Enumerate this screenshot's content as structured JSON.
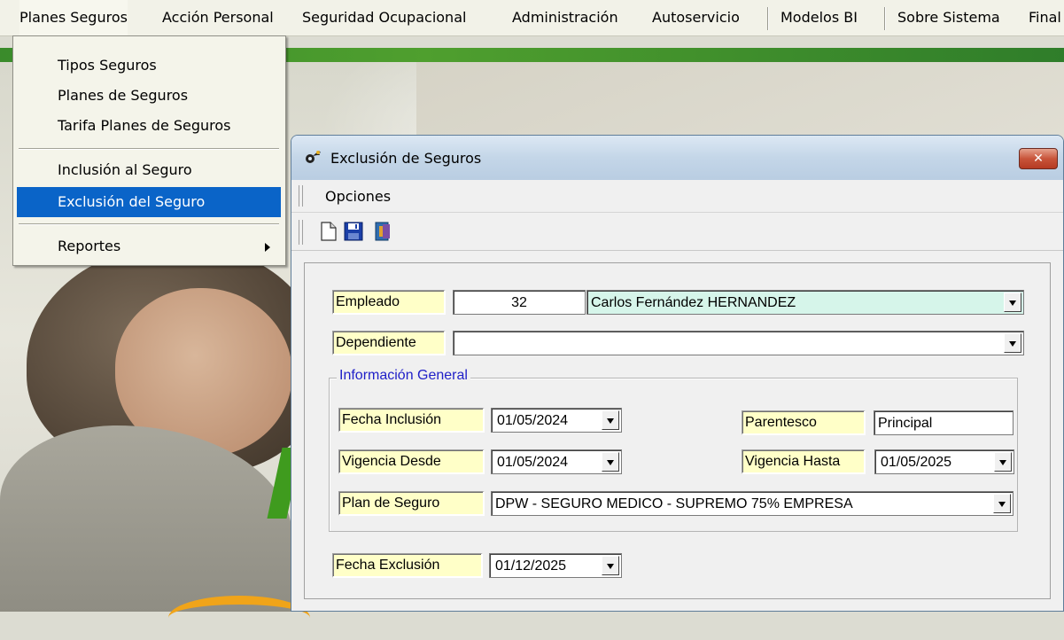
{
  "menubar": {
    "items": [
      {
        "label": "Planes Seguros"
      },
      {
        "label": "Acción Personal"
      },
      {
        "label": "Seguridad Ocupacional"
      },
      {
        "label": "Administración"
      },
      {
        "label": "Autoservicio"
      },
      {
        "label": "Modelos BI"
      },
      {
        "label": "Sobre Sistema"
      },
      {
        "label": "Final"
      }
    ]
  },
  "dropdown": {
    "items": [
      {
        "label": "Tipos Seguros"
      },
      {
        "label": "Planes de Seguros"
      },
      {
        "label": "Tarifa Planes de Seguros"
      },
      {
        "label": "Inclusión al Seguro"
      },
      {
        "label": "Exclusión del Seguro"
      },
      {
        "label": "Reportes"
      }
    ],
    "selected": "Exclusión del Seguro"
  },
  "window": {
    "title": "Exclusión de Seguros",
    "close_label": "✕",
    "menu_opciones": "Opciones",
    "toolbar_icons": [
      "new-document-icon",
      "save-icon",
      "exit-icon"
    ]
  },
  "form": {
    "empleado_label": "Empleado",
    "empleado_id": "32",
    "empleado_name": "Carlos Fernández HERNANDEZ",
    "dependiente_label": "Dependiente",
    "dependiente_value": "",
    "group_title": "Información General",
    "fecha_inclusion_label": "Fecha Inclusión",
    "fecha_inclusion_value": "01/05/2024",
    "parentesco_label": "Parentesco",
    "parentesco_value": "Principal",
    "vigencia_desde_label": "Vigencia Desde",
    "vigencia_desde_value": "01/05/2024",
    "vigencia_hasta_label": "Vigencia Hasta",
    "vigencia_hasta_value": "01/05/2025",
    "plan_label": "Plan de Seguro",
    "plan_value": "DPW - SEGURO MEDICO - SUPREMO 75% EMPRESA",
    "fecha_exclusion_label": "Fecha Exclusión",
    "fecha_exclusion_value": "01/12/2025"
  },
  "colors": {
    "menu_selection": "#0a64c8",
    "label_background": "#ffffc8",
    "group_title": "#2020c8",
    "employee_name_background": "#d6f5ea"
  }
}
